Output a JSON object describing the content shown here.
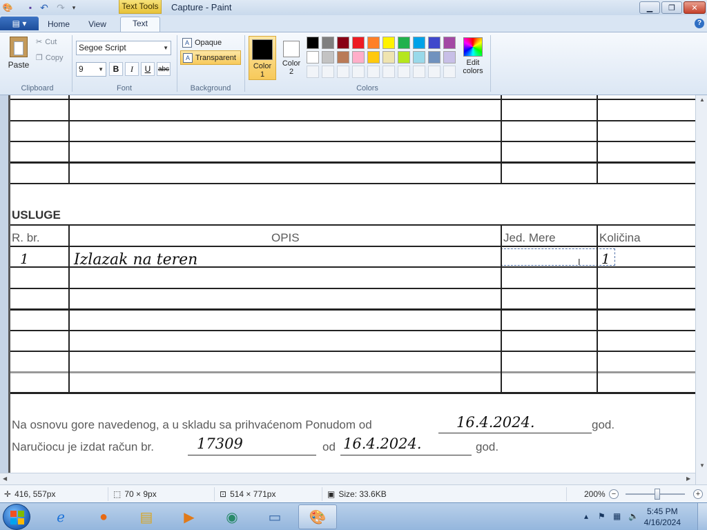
{
  "titlebar": {
    "app_title": "Capture - Paint",
    "context_tab": "Text Tools",
    "quick_access": [
      "paint-app-icon",
      "save-icon",
      "undo-icon",
      "redo-icon",
      "customize-qa-icon"
    ],
    "controls": [
      "minimize",
      "maximize",
      "close"
    ]
  },
  "tabs": {
    "file_label": "▤ ▾",
    "items": [
      {
        "label": "Home"
      },
      {
        "label": "View"
      },
      {
        "label": "Text"
      }
    ],
    "active": "Text"
  },
  "ribbon": {
    "clipboard": {
      "paste": "Paste",
      "cut": "Cut",
      "copy": "Copy",
      "group": "Clipboard"
    },
    "font": {
      "family": "Segoe Script",
      "size": "9",
      "bold": "B",
      "italic": "I",
      "underline": "U",
      "strike": "abc",
      "group": "Font"
    },
    "background": {
      "opaque": "Opaque",
      "transparent": "Transparent",
      "active": "Transparent",
      "group": "Background"
    },
    "colors": {
      "color1_label": "Color\n1",
      "color1_a": "Color",
      "color1_b": "1",
      "color2_a": "Color",
      "color2_b": "2",
      "color1_value": "#000000",
      "color2_value": "#ffffff",
      "edit_a": "Edit",
      "edit_b": "colors",
      "group": "Colors",
      "palette_row1": [
        "#000000",
        "#7f7f7f",
        "#880015",
        "#ed1c24",
        "#ff7f27",
        "#fff200",
        "#22b14c",
        "#00a2e8",
        "#3f48cc",
        "#a349a4"
      ],
      "palette_row2": [
        "#ffffff",
        "#c3c3c3",
        "#b97a57",
        "#ffaec9",
        "#ffc90e",
        "#efe4b0",
        "#b5e61d",
        "#99d9ea",
        "#7092be",
        "#c8bfe7"
      ]
    }
  },
  "document": {
    "section_title": "USLUGE",
    "headers": {
      "rbr": "R. br.",
      "opis": "OPIS",
      "jed": "Jed. Mere",
      "kol": "Količina"
    },
    "row1": {
      "rbr": "1",
      "opis": "Izlazak na teren",
      "kol": "1"
    },
    "line1_text": "Na osnovu gore navedenog, a u skladu sa prihvaćenom Ponudom  od",
    "line1_date": "16.4.2024.",
    "line1_end": "god.",
    "line2_text": "Naručiocu je izdat račun br.",
    "line2_number": "17309",
    "line2_mid": "od",
    "line2_date": "16.4.2024.",
    "line2_end": "god."
  },
  "statusbar": {
    "cursor_pos": "416, 557px",
    "selection_size": "70 × 9px",
    "image_size": "514 × 771px",
    "file_size": "Size: 33.6KB",
    "zoom": "200%",
    "zoom_level_fraction": 0.53
  },
  "taskbar": {
    "items": [
      "start",
      "internet-explorer",
      "firefox",
      "file-explorer",
      "media-player",
      "chat-app",
      "photo-viewer",
      "paint"
    ],
    "active": "paint",
    "time": "5:45 PM",
    "date": "4/16/2024"
  }
}
